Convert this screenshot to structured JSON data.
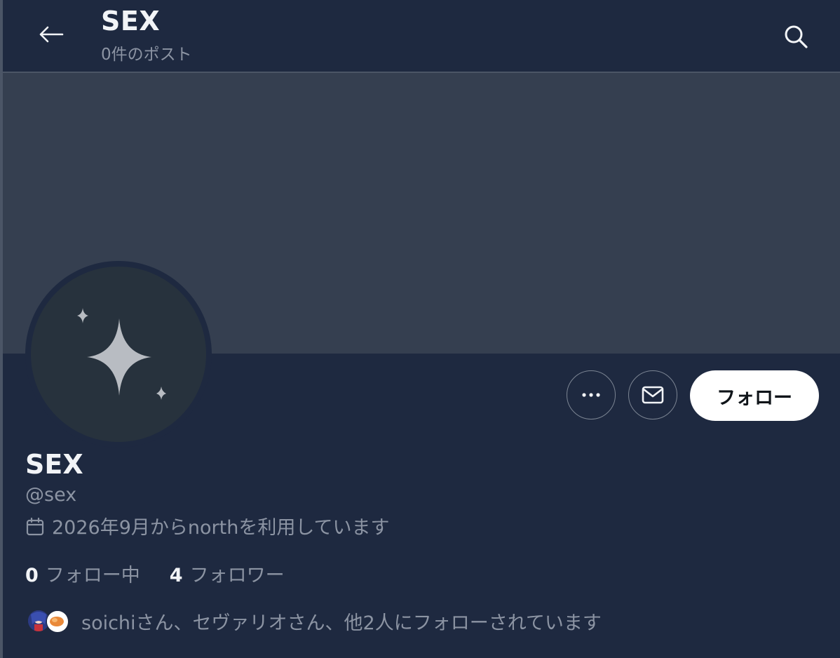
{
  "header": {
    "title": "SEX",
    "post_count": "0件のポスト",
    "back_icon": "back-arrow-icon",
    "search_icon": "search-icon"
  },
  "profile": {
    "display_name": "SEX",
    "handle": "@sex",
    "joined": "2026年9月からnorthを利用しています",
    "avatar_icon": "sparkle-icon"
  },
  "actions": {
    "more_icon": "more-icon",
    "message_icon": "mail-icon",
    "follow_label": "フォロー"
  },
  "stats": {
    "following_count": "0",
    "following_label": "フォロー中",
    "followers_count": "4",
    "followers_label": "フォロワー"
  },
  "followed_by": {
    "text": "soichiさん、セヴァリオさん、他2人にフォローされています"
  },
  "colors": {
    "background": "#1e2940",
    "banner": "#353f50",
    "avatar": "#27323d",
    "muted_text": "#8c94a3",
    "primary_text": "#f2f4f7",
    "follow_button": "#ffffff"
  }
}
